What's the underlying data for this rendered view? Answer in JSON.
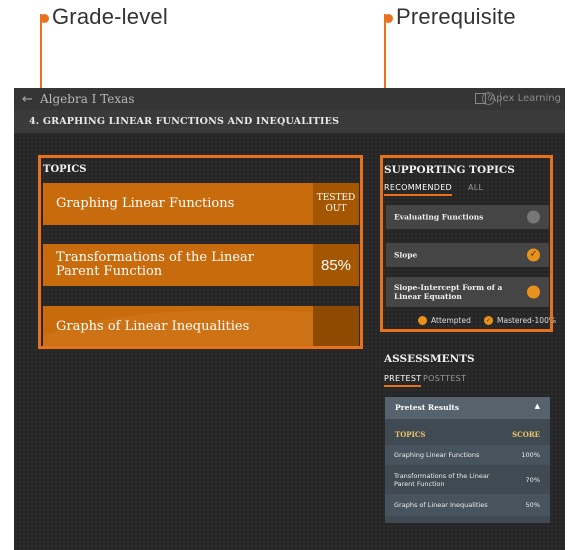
{
  "callouts": {
    "grade_level": "Grade-level",
    "prerequisite": "Prerequisite"
  },
  "app": {
    "title": "Algebra I Texas",
    "brand": "Apex Learning",
    "unit_title": "4. GRAPHING LINEAR FUNCTIONS AND INEQUALITIES"
  },
  "topics": {
    "label": "TOPICS",
    "items": [
      {
        "name": "Graphing Linear Functions",
        "status": "TESTED OUT"
      },
      {
        "name": "Transformations of the Linear Parent Function",
        "status": "85%"
      },
      {
        "name": "Graphs of Linear Inequalities",
        "status": ""
      }
    ]
  },
  "supporting": {
    "label": "SUPPORTING TOPICS",
    "tabs": [
      "RECOMMENDED",
      "ALL"
    ],
    "items": [
      {
        "label": "Evaluating Functions",
        "state": "none"
      },
      {
        "label": "Slope",
        "state": "mastered"
      },
      {
        "label": "Slope-Intercept Form of a Linear Equation",
        "state": "attempted"
      }
    ],
    "legend": {
      "attempted": "Attempted",
      "mastered": "Mastered-100%"
    }
  },
  "assessments": {
    "label": "ASSESSMENTS",
    "tabs": [
      "PRETEST",
      "POSTTEST"
    ],
    "results_title": "Pretest Results",
    "col_topics": "TOPICS",
    "col_score": "SCORE",
    "rows": [
      {
        "topic": "Graphing Linear Functions",
        "score": "100%"
      },
      {
        "topic": "Transformations of the Linear Parent Function",
        "score": "70%"
      },
      {
        "topic": "Graphs of Linear Inequalities",
        "score": "50%"
      }
    ]
  },
  "colors": {
    "accent": "#e8721b",
    "topic_fill": "#c86b0c",
    "background": "#262626"
  }
}
